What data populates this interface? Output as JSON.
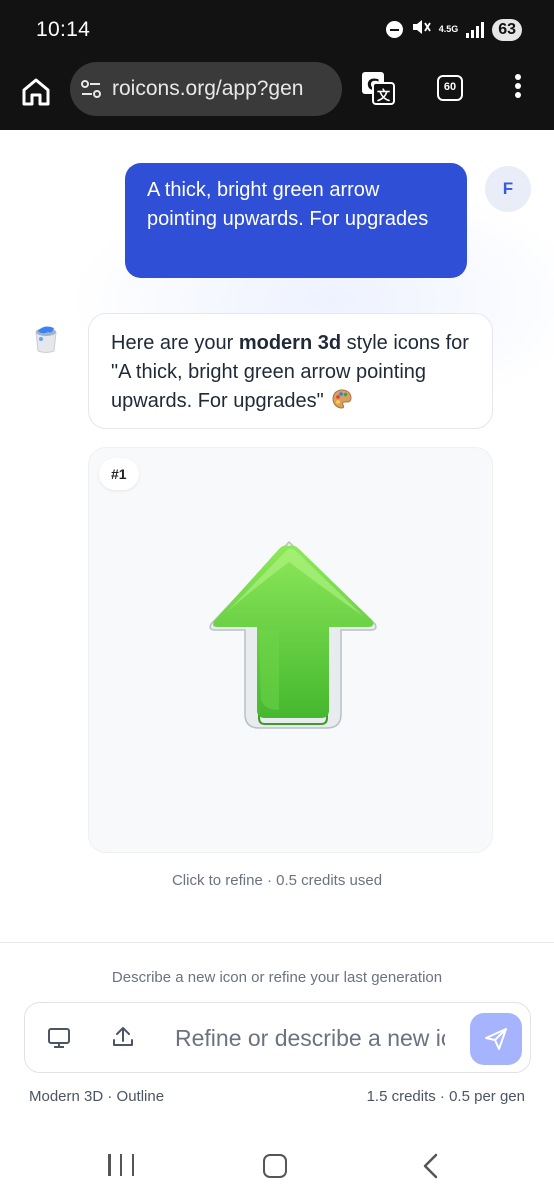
{
  "status_bar": {
    "time": "10:14",
    "network": "4.5G",
    "battery": "63",
    "icons": [
      "do-not-disturb-icon",
      "mute-icon",
      "signal-icon",
      "battery-icon"
    ]
  },
  "browser": {
    "url": "roicons.org/app?gen",
    "tab_count": "60",
    "icons": [
      "home-icon",
      "site-settings-icon",
      "translate-icon",
      "tab-switcher-icon",
      "menu-icon"
    ]
  },
  "chat": {
    "user_message": "A thick, bright green arrow pointing upwards. For upgrades",
    "user_initial": "F",
    "bot_message": {
      "prefix": "Here are your ",
      "style": "modern 3d",
      "suffix": " style icons for \"A thick, bright green arrow pointing upwards. For upgrades\""
    },
    "results": [
      {
        "index": "#1",
        "subject": "green-up-arrow"
      }
    ],
    "refine_hint": "Click to refine · 0.5 credits used"
  },
  "composer": {
    "hint": "Describe a new icon or refine your last generation",
    "placeholder": "Refine or describe a new icon...",
    "style_info": "Modern 3D · Outline",
    "credits_info": "1.5 credits · 0.5 per gen"
  },
  "colors": {
    "user_bubble": "#2f4fd6",
    "send_button": "#a5b4fc",
    "arrow_green": "#5ccb3b"
  }
}
